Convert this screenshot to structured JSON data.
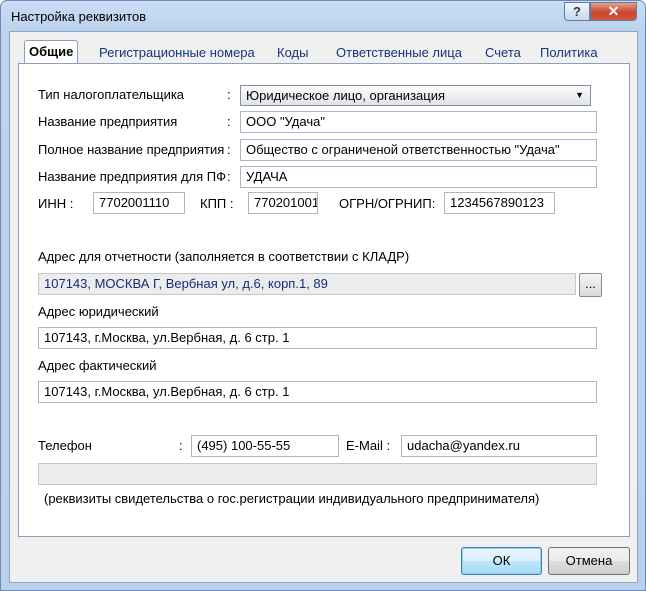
{
  "window": {
    "title": "Настройка реквизитов",
    "help_label": "?",
    "close_label": "✕"
  },
  "tabs": [
    {
      "label": "Общие",
      "active": true
    },
    {
      "label": "Регистрационные номера",
      "active": false
    },
    {
      "label": "Коды",
      "active": false
    },
    {
      "label": "Ответственные лица",
      "active": false
    },
    {
      "label": "Счета",
      "active": false
    },
    {
      "label": "Политика",
      "active": false
    }
  ],
  "form": {
    "taxpayer_type": {
      "label": "Тип налогоплательщика",
      "colon": ":",
      "value": "Юридическое лицо, организация"
    },
    "org_name": {
      "label": "Название предприятия",
      "colon": ":",
      "value": "ООО \"Удача\""
    },
    "full_name": {
      "label": "Полное название предприятия",
      "colon": ":",
      "value": "Общество с ограниченой ответственностью \"Удача\""
    },
    "pf_name": {
      "label": "Название предприятия для ПФ",
      "colon": ":",
      "value": "УДАЧА"
    },
    "inn": {
      "label": "ИНН :",
      "value": "7702001110"
    },
    "kpp": {
      "label": "КПП :",
      "value": "770201001"
    },
    "ogrn": {
      "label": "ОГРН/ОГРНИП:",
      "value": "1234567890123"
    },
    "report_address": {
      "label": "Адрес для отчетности (заполняется в соответствии с КЛАДР)",
      "value": "107143, МОСКВА Г, Вербная ул, д.6, корп.1, 89",
      "browse_label": "..."
    },
    "legal_address": {
      "label": "Адрес юридический",
      "value": "107143, г.Москва, ул.Вербная, д. 6 стр. 1"
    },
    "actual_address": {
      "label": "Адрес фактический",
      "value": "107143, г.Москва, ул.Вербная, д. 6 стр. 1"
    },
    "phone": {
      "label": "Телефон",
      "colon": ":",
      "value": "(495) 100-55-55"
    },
    "email": {
      "label": "E-Mail :",
      "value": "udacha@yandex.ru"
    },
    "registration_cert": {
      "value": "",
      "note": "(реквизиты свидетельства о гос.регистрации индивидуального предпринимателя)"
    }
  },
  "buttons": {
    "ok": "ОК",
    "cancel": "Отмена"
  }
}
